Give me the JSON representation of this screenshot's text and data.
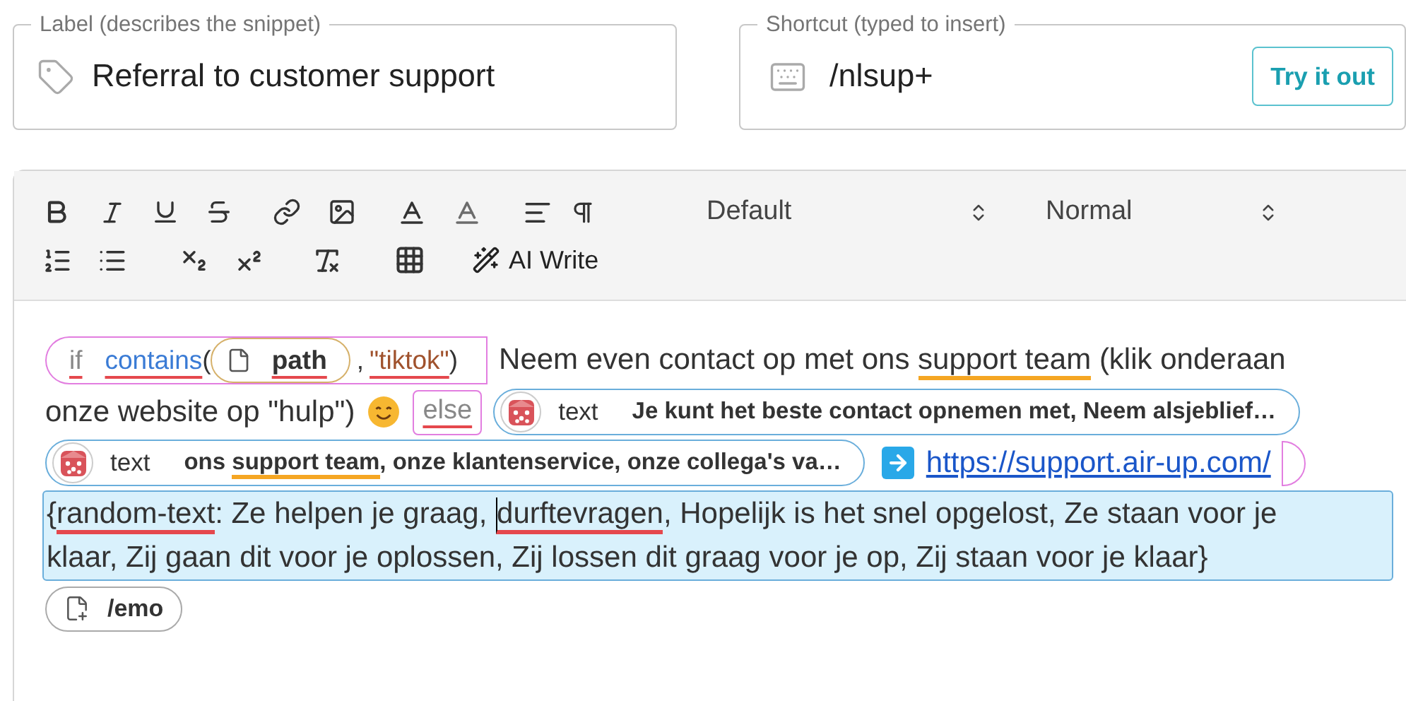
{
  "label_field": {
    "legend": "Label (describes the snippet)",
    "value": "Referral to customer support"
  },
  "shortcut_field": {
    "legend": "Shortcut (typed to insert)",
    "value": "/nlsup+",
    "button": "Try it out"
  },
  "toolbar": {
    "font_select": "Default",
    "size_select": "Normal",
    "ai_button": "AI Write"
  },
  "lines": [
    {
      "segments": [
        {
          "kind": "condition",
          "keyword": "if",
          "function": "contains",
          "open": "(",
          "variable": "path",
          "separator": ",",
          "argument": "\"tiktok\"",
          "close": ")"
        },
        {
          "kind": "text",
          "parts": [
            {
              "text": "Neem even contact op met ons "
            },
            {
              "text": "support team",
              "color": "#f5a623"
            },
            {
              "text": " (klik onderaan"
            }
          ]
        }
      ]
    },
    {
      "segments": [
        {
          "kind": "text",
          "parts": [
            {
              "text": "onze website op \"hulp\")"
            }
          ]
        },
        {
          "kind": "emoji"
        },
        {
          "kind": "else",
          "text": "else"
        },
        {
          "kind": "random",
          "label": "text",
          "parts": [
            {
              "text": "Je kunt het beste contact opnemen met, Neem alsjeblief…"
            }
          ]
        }
      ]
    },
    {
      "segments": [
        {
          "kind": "random",
          "label": "text",
          "parts": [
            {
              "text": "ons "
            },
            {
              "text": "support team",
              "color": "#f5a623"
            },
            {
              "text": ", onze klantenservice, onze collega's va…"
            }
          ]
        },
        {
          "kind": "link",
          "text": "https://support.air-up.com/"
        },
        {
          "kind": "condition_end"
        }
      ]
    },
    {
      "segments": [
        {
          "kind": "random_text",
          "parts": [
            {
              "text": "{"
            },
            {
              "text": "random-text",
              "color": "#e5484d"
            },
            {
              "text": ": Ze helpen je graag, "
            },
            {
              "text": "durftevragen",
              "color": "#e5484d",
              "cursor": true
            },
            {
              "text": ", Hopelijk is het snel opgelost, Ze staan voor je klaar, Zij gaan dit voor je oplossen, Zij lossen dit graag voor je op, Zij staan voor je klaar}"
            }
          ]
        }
      ]
    },
    {
      "segments": [
        {
          "kind": "command",
          "text": "/emo"
        }
      ]
    }
  ]
}
